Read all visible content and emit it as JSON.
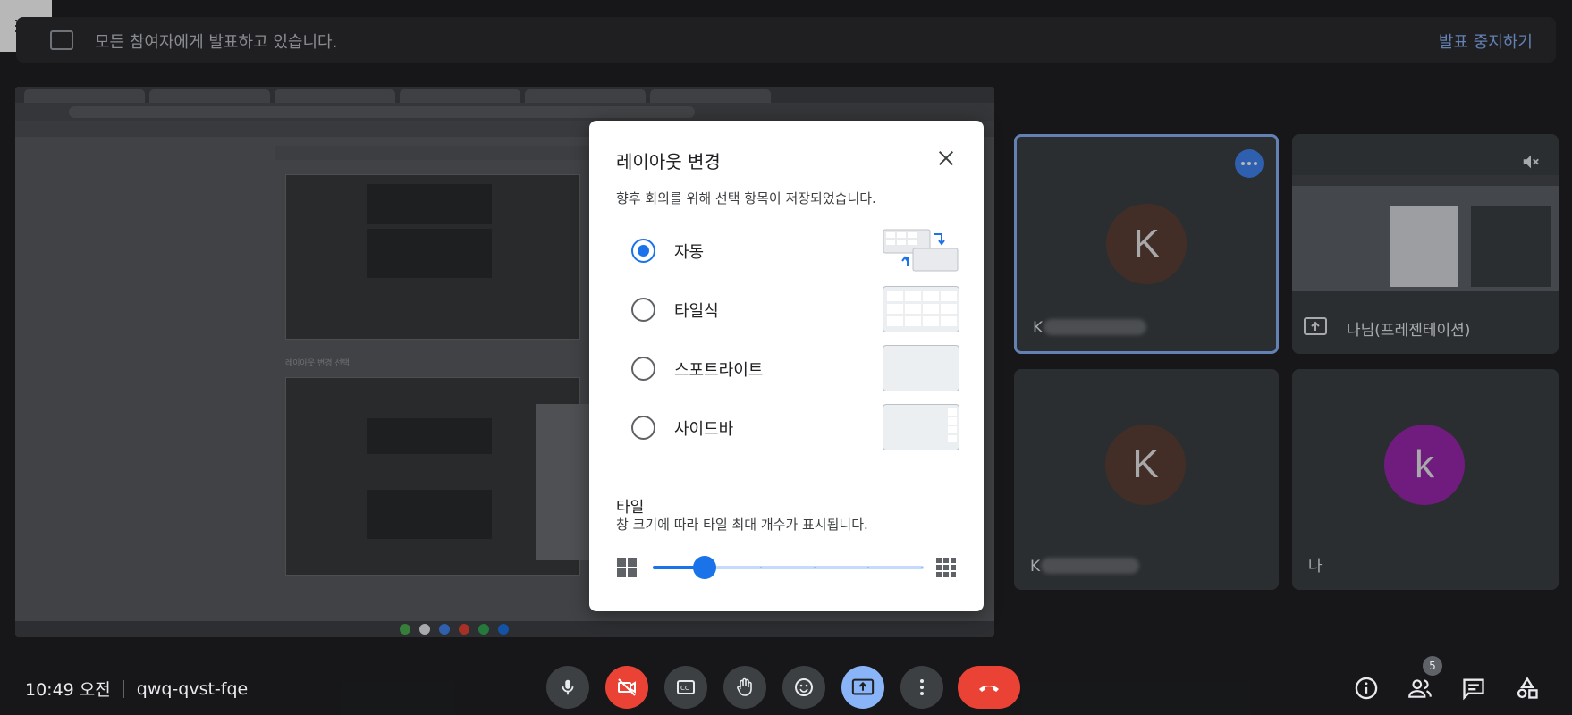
{
  "banner": {
    "message": "모든 참여자에게 발표하고 있습니다.",
    "stop_label": "발표 중지하기"
  },
  "meeting": {
    "time": "10:49 오전",
    "code": "qwq-qvst-fqe",
    "participants_count": "5"
  },
  "shared_screen": {
    "caption": "레이아웃 변경 선택"
  },
  "participants": [
    {
      "initial": "K",
      "name": "K",
      "avatar_color": "#5d4037",
      "active": true
    },
    {
      "initial": "",
      "name": "나님(프레젠테이션)",
      "avatar_color": "",
      "active": false
    },
    {
      "initial": "K",
      "name": "K",
      "avatar_color": "#5d4037",
      "active": false
    },
    {
      "initial": "k",
      "name": "나",
      "avatar_color": "#9c27b0",
      "active": false
    }
  ],
  "dialog": {
    "title": "레이아웃 변경",
    "subtitle": "향후 회의를 위해 선택 항목이 저장되었습니다.",
    "options": [
      {
        "label": "자동",
        "selected": true,
        "thumb": "auto"
      },
      {
        "label": "타일식",
        "selected": false,
        "thumb": "tiled"
      },
      {
        "label": "스포트라이트",
        "selected": false,
        "thumb": "spotlight"
      },
      {
        "label": "사이드바",
        "selected": false,
        "thumb": "sidebar"
      }
    ],
    "tiles_label": "타일",
    "tiles_desc": "창 크기에 따라 타일 최대 개수가 표시됩니다.",
    "slider_value": 0.19
  },
  "colors": {
    "accent": "#1a73e8",
    "link": "#8ab4f8",
    "danger": "#ea4335"
  }
}
